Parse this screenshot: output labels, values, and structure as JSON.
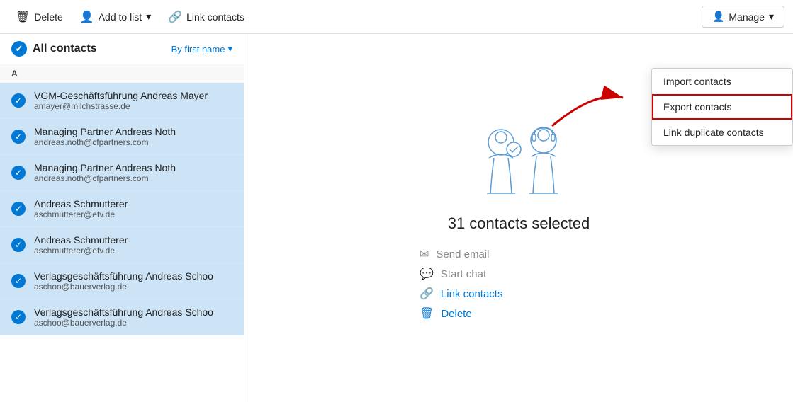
{
  "toolbar": {
    "delete_label": "Delete",
    "add_to_list_label": "Add to list",
    "link_contacts_label": "Link contacts",
    "manage_label": "Manage"
  },
  "sidebar": {
    "header": {
      "title": "All contacts",
      "sort_label": "By first name"
    },
    "section_a": "A",
    "contacts": [
      {
        "name": "VGM-Geschäftsführung Andreas Mayer",
        "email": "amayer@milchstrasse.de"
      },
      {
        "name": "Managing Partner Andreas Noth",
        "email": "andreas.noth@cfpartners.com"
      },
      {
        "name": "Managing Partner Andreas Noth",
        "email": "andreas.noth@cfpartners.com"
      },
      {
        "name": "Andreas Schmutterer",
        "email": "aschmutterer@efv.de"
      },
      {
        "name": "Andreas Schmutterer",
        "email": "aschmutterer@efv.de"
      },
      {
        "name": "Verlagsgeschäftsführung Andreas Schoo",
        "email": "aschoo@bauerverlag.de"
      },
      {
        "name": "Verlagsgeschäftsführung Andreas Schoo",
        "email": "aschoo@bauerverlag.de"
      }
    ]
  },
  "main": {
    "selected_count": "31 contacts selected",
    "actions": [
      {
        "label": "Send email",
        "icon": "✉",
        "active": false
      },
      {
        "label": "Start chat",
        "icon": "💬",
        "active": false
      },
      {
        "label": "Link contacts",
        "icon": "🔗",
        "active": true
      },
      {
        "label": "Delete",
        "icon": "🗑",
        "active": true
      }
    ]
  },
  "dropdown": {
    "items": [
      {
        "label": "Import contacts",
        "highlighted": false
      },
      {
        "label": "Export contacts",
        "highlighted": true
      },
      {
        "label": "Link duplicate contacts",
        "highlighted": false
      }
    ]
  }
}
